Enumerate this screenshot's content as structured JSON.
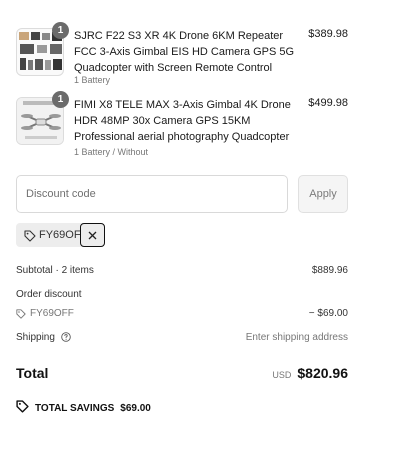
{
  "items": [
    {
      "quantity": "1",
      "title": "SJRC F22 S3 XR 4K Drone 6KM Repeater FCC 3-Axis Gimbal EIS HD Camera GPS 5G Quadcopter with Screen Remote Control",
      "variant": "1 Battery",
      "price": "$389.98",
      "thumbnail_icon": "drone-kit-thumbnail"
    },
    {
      "quantity": "1",
      "title": "FIMI X8 TELE MAX 3-Axis Gimbal 4K Drone HDR 48MP 30x Camera GPS 15KM Professional aerial photography Quadcopter",
      "variant": "1 Battery / Without",
      "price": "$499.98",
      "thumbnail_icon": "drone-thumbnail"
    }
  ],
  "discount": {
    "placeholder": "Discount code",
    "value": "",
    "apply_label": "Apply",
    "applied_code": "FY69OFF"
  },
  "summary": {
    "subtotal_label": "Subtotal · 2 items",
    "subtotal_value": "$889.96",
    "order_discount_label": "Order discount",
    "order_discount_code": "FY69OFF",
    "order_discount_value": "− $69.00",
    "shipping_label": "Shipping",
    "shipping_value": "Enter shipping address",
    "total_label": "Total",
    "total_currency": "USD",
    "total_value": "$820.96",
    "savings_label": "TOTAL SAVINGS",
    "savings_value": "$69.00"
  }
}
